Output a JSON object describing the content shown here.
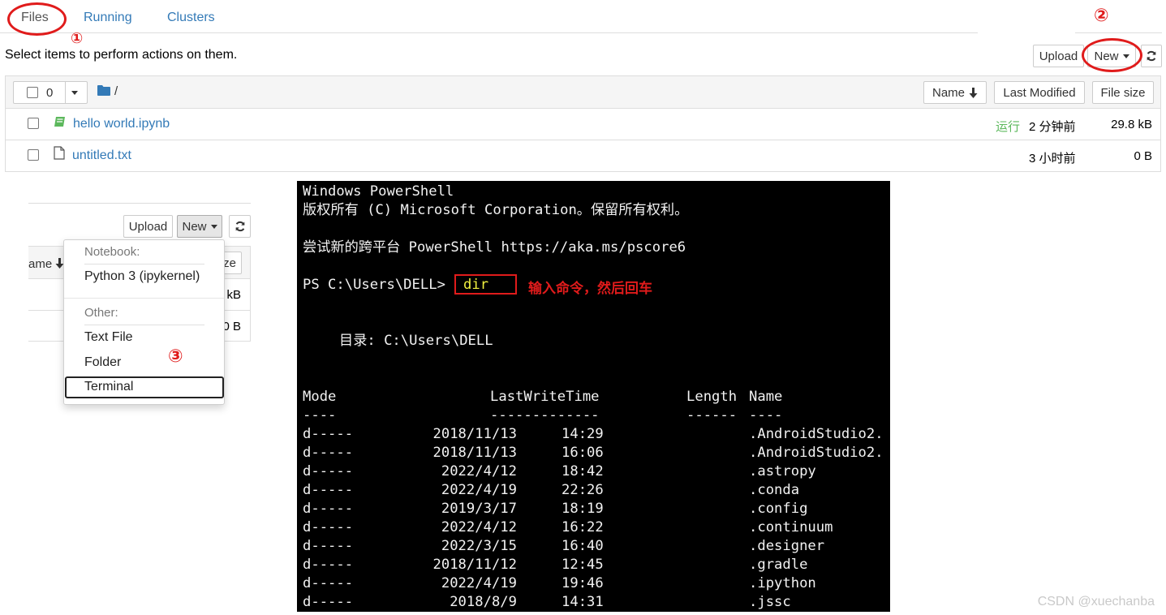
{
  "top": {
    "tabs": [
      "Files",
      "Running",
      "Clusters"
    ],
    "hint": "Select items to perform actions on them.",
    "upload_label": "Upload",
    "new_label": "New",
    "select_count": "0",
    "breadcrumb": "/",
    "sort_buttons": [
      "Name",
      "Last Modified",
      "File size"
    ],
    "files": [
      {
        "name": "hello world.ipynb",
        "status": "运行",
        "modified": "2 分钟前",
        "size": "29.8 kB"
      },
      {
        "name": "untitled.txt",
        "status": "",
        "modified": "3 小时前",
        "size": "0 B"
      }
    ],
    "marks": [
      "①",
      "②"
    ]
  },
  "lower": {
    "upload_label": "Upload",
    "new_label": "New",
    "peek_name": "ame",
    "peek_size": "ze",
    "peek_kb": "kB",
    "peek_b": "0 B",
    "menu": {
      "notebook_header": "Notebook:",
      "python": "Python 3 (ipykernel)",
      "other_header": "Other:",
      "text_file": "Text File",
      "folder": "Folder",
      "terminal": "Terminal"
    },
    "mark": "③"
  },
  "terminal": {
    "banner1": "Windows PowerShell",
    "banner2": "版权所有 (C) Microsoft Corporation。保留所有权利。",
    "banner3": "尝试新的跨平台 PowerShell https://aka.ms/pscore6",
    "prompt": "PS C:\\Users\\DELL>",
    "command": "dir",
    "note": "输入命令，然后回车",
    "dir_line": "目录: C:\\Users\\DELL",
    "headers": {
      "mode": "Mode",
      "time": "LastWriteTime",
      "length": "Length",
      "name": "Name"
    },
    "underline": {
      "mode": "----",
      "time": "-------------",
      "length": "------",
      "name": "----"
    },
    "rows": [
      {
        "mode": "d-----",
        "date": "2018/11/13",
        "time": "14:29",
        "name": ".AndroidStudio2."
      },
      {
        "mode": "d-----",
        "date": "2018/11/13",
        "time": "16:06",
        "name": ".AndroidStudio2."
      },
      {
        "mode": "d-----",
        "date": "2022/4/12",
        "time": "18:42",
        "name": ".astropy"
      },
      {
        "mode": "d-----",
        "date": "2022/4/19",
        "time": "22:26",
        "name": ".conda"
      },
      {
        "mode": "d-----",
        "date": "2019/3/17",
        "time": "18:19",
        "name": ".config"
      },
      {
        "mode": "d-----",
        "date": "2022/4/12",
        "time": "16:22",
        "name": ".continuum"
      },
      {
        "mode": "d-----",
        "date": "2022/3/15",
        "time": "16:40",
        "name": ".designer"
      },
      {
        "mode": "d-----",
        "date": "2018/11/12",
        "time": "12:45",
        "name": ".gradle"
      },
      {
        "mode": "d-----",
        "date": "2022/4/19",
        "time": "19:46",
        "name": ".ipython"
      },
      {
        "mode": "d-----",
        "date": "2018/8/9",
        "time": "14:31",
        "name": ".jssc"
      }
    ]
  },
  "watermark": "CSDN @xuechanba",
  "colors": {
    "link": "#337ab7",
    "annotation": "#e01b1b",
    "running": "#5cb85c",
    "terminal_bg": "#000000"
  }
}
